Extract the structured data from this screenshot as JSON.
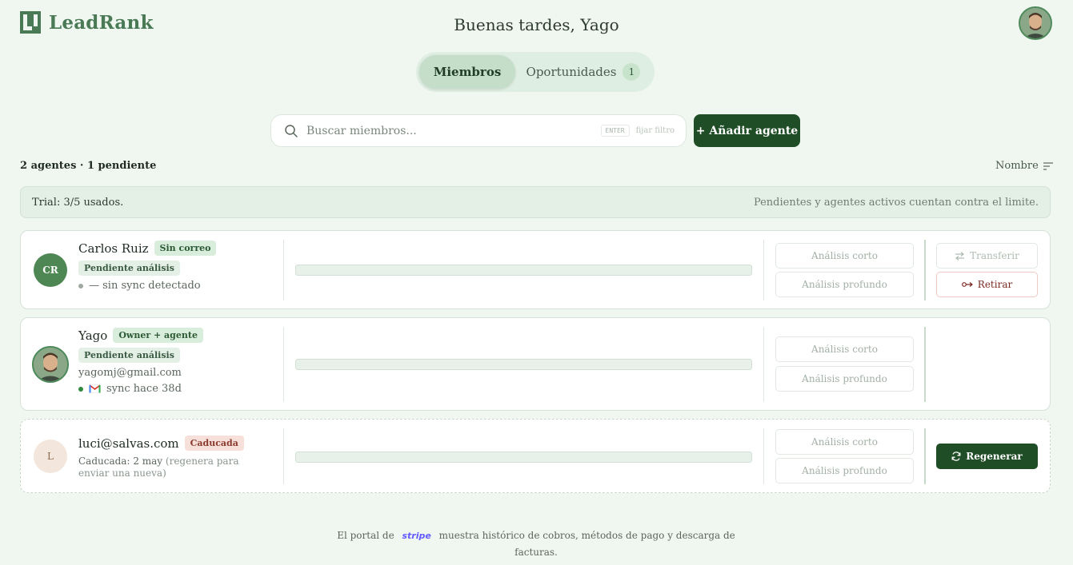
{
  "brand": {
    "name": "LeadRank",
    "color": "#4a7a55"
  },
  "header": {
    "greeting": "Buenas tardes, Yago"
  },
  "tabs": [
    {
      "label": "Miembros",
      "active": true
    },
    {
      "label": "Oportunidades",
      "active": false,
      "badge": "1"
    }
  ],
  "search": {
    "placeholder": "Buscar miembros...",
    "value": "",
    "kbd": "ENTER",
    "hint": "fijar filtro"
  },
  "add_button": {
    "label": "+ Añadir agente"
  },
  "summary": {
    "count": "2 agentes · 1 pendiente",
    "sort_label": "Nombre"
  },
  "trial": {
    "left": "Trial: 3/5 usados.",
    "right": "Pendientes y agentes activos cuentan contra el limite."
  },
  "members": [
    {
      "initials": "CR",
      "name": "Carlos Ruiz",
      "badge": "Sin correo",
      "pending": "Pendiente análisis",
      "sync": "— sin sync detectado",
      "sync_status_color": "#a0a8a2",
      "actions": [
        "Análisis corto",
        "Análisis profundo"
      ],
      "right_actions": [
        "Transferir",
        "Retirar"
      ]
    },
    {
      "initials": "",
      "name": "Yago",
      "badge": "Owner + agente",
      "pending": "Pendiente análisis",
      "email": "yagomj@gmail.com",
      "sync": "sync hace 38d",
      "sync_status_color": "#2f8a3e",
      "actions": [
        "Análisis corto",
        "Análisis profundo"
      ]
    },
    {
      "initials": "L",
      "name": "luci@salvas.com",
      "badge": "Caducada",
      "meta_main": "Caducada: 2 may",
      "meta_note": "(regenera para enviar una nueva)",
      "actions": [
        "Análisis corto",
        "Análisis profundo"
      ],
      "right_actions": [
        "Regenerar"
      ]
    }
  ],
  "footer": {
    "before": "El portal de",
    "stripe": "stripe",
    "after": "muestra histórico de cobros, métodos de pago y descarga de facturas."
  }
}
